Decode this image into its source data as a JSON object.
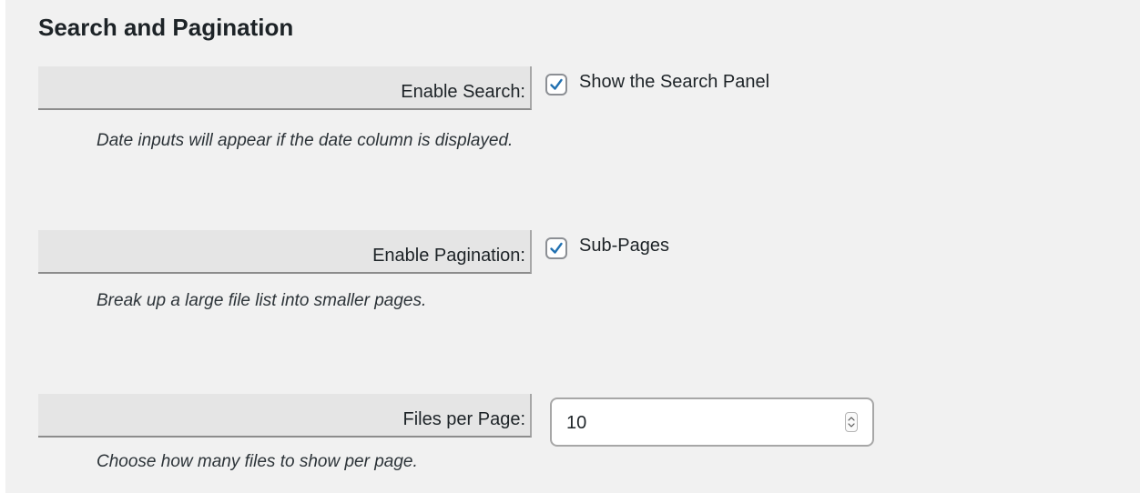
{
  "section": {
    "title": "Search and Pagination"
  },
  "search": {
    "label": "Enable Search:",
    "checkbox_label": "Show the Search Panel",
    "checked": true,
    "description": "Date inputs will appear if the date column is displayed."
  },
  "pagination": {
    "label": "Enable Pagination:",
    "checkbox_label": "Sub-Pages",
    "checked": true,
    "description": "Break up a large file list into smaller pages."
  },
  "files_per_page": {
    "label": "Files per Page:",
    "value": "10",
    "description": "Choose how many files to show per page."
  },
  "colors": {
    "panel_bg": "#f1f1f1",
    "label_bg": "#e5e5e5",
    "checkmark": "#2271b1",
    "text": "#1d2327"
  },
  "icons": {
    "checkbox_checked": "checkmark-icon",
    "spinner": "spinner-arrows-icon"
  }
}
